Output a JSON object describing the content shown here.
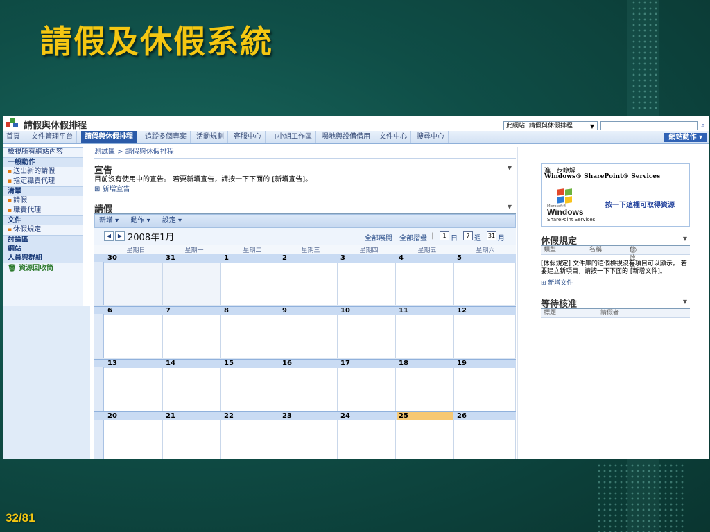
{
  "slide": {
    "title": "請假及休假系統",
    "page_number": "32/81"
  },
  "site": {
    "title": "請假與休假排程",
    "scope_label": "此網站: 請假與休假排程",
    "site_actions": "網站動作 ▾"
  },
  "topnav": {
    "tabs": [
      "首頁",
      "文件管理平台",
      "請假與休假排程",
      "追蹤多個專案",
      "活動規劃",
      "客服中心",
      "IT小組工作區",
      "場地與設備借用",
      "文件中心",
      "搜尋中心"
    ],
    "selected": "請假與休假排程"
  },
  "quicklaunch": {
    "view_all": "檢視所有網站內容",
    "general_header": "一般動作",
    "general_items": [
      "送出新的請假",
      "指定職責代理"
    ],
    "lists_header": "清單",
    "list_items": [
      "請假",
      "職責代理"
    ],
    "docs_header": "文件",
    "doc_items": [
      "休假規定"
    ],
    "discussions": "討論區",
    "sites": "網站",
    "people": "人員與群組",
    "recycle": "資源回收筒"
  },
  "breadcrumb": "測試區 > 請假與休假排程",
  "announcements": {
    "title": "宣告",
    "empty_text": "目前沒有使用中的宣告。 若要新增宣告，請按一下下面的 [新增宣告]。",
    "add_link": "新增宣告"
  },
  "leave": {
    "title": "請假",
    "toolbar": {
      "new": "新增 ▾",
      "actions": "動作 ▾",
      "settings": "設定 ▾"
    }
  },
  "calendar": {
    "month_title": "2008年1月",
    "expand_all": "全部展開",
    "collapse_all": "全部摺疊",
    "day_view": "日",
    "week_view": "週",
    "month_view": "月",
    "day_icon": "1",
    "week_icon": "7",
    "month_icon": "31",
    "weekdays": [
      "星期日",
      "星期一",
      "星期二",
      "星期三",
      "星期四",
      "星期五",
      "星期六"
    ],
    "weeks": [
      [
        "30",
        "31",
        "1",
        "2",
        "3",
        "4",
        "5"
      ],
      [
        "6",
        "7",
        "8",
        "9",
        "10",
        "11",
        "12"
      ],
      [
        "13",
        "14",
        "15",
        "16",
        "17",
        "18",
        "19"
      ],
      [
        "20",
        "21",
        "22",
        "23",
        "24",
        "25",
        "26"
      ]
    ],
    "today": "25"
  },
  "sharepoint_ad": {
    "line1": "進一步瞭解",
    "line2": "Windows® SharePoint® Services",
    "ms": "Microsoft®",
    "windows": "Windows",
    "services": "SharePoint Services",
    "link": "按一下這裡可取得資源"
  },
  "leave_rules": {
    "title": "休假規定",
    "columns": [
      "類型",
      "名稱",
      "修改者"
    ],
    "empty_text": "[休假規定] 文件庫的這個檢視沒有項目可以顯示。 若要建立新項目，請按一下下面的 [新增文件]。",
    "add_link": "新增文件"
  },
  "pending": {
    "title": "等待核准",
    "columns": [
      "標題",
      "請假者"
    ]
  },
  "colors": {
    "title_gold": "#f5c712",
    "nav_selected": "#2a5aa8",
    "today_highlight": "#f7c872",
    "background_teal": "#0f4e47"
  }
}
